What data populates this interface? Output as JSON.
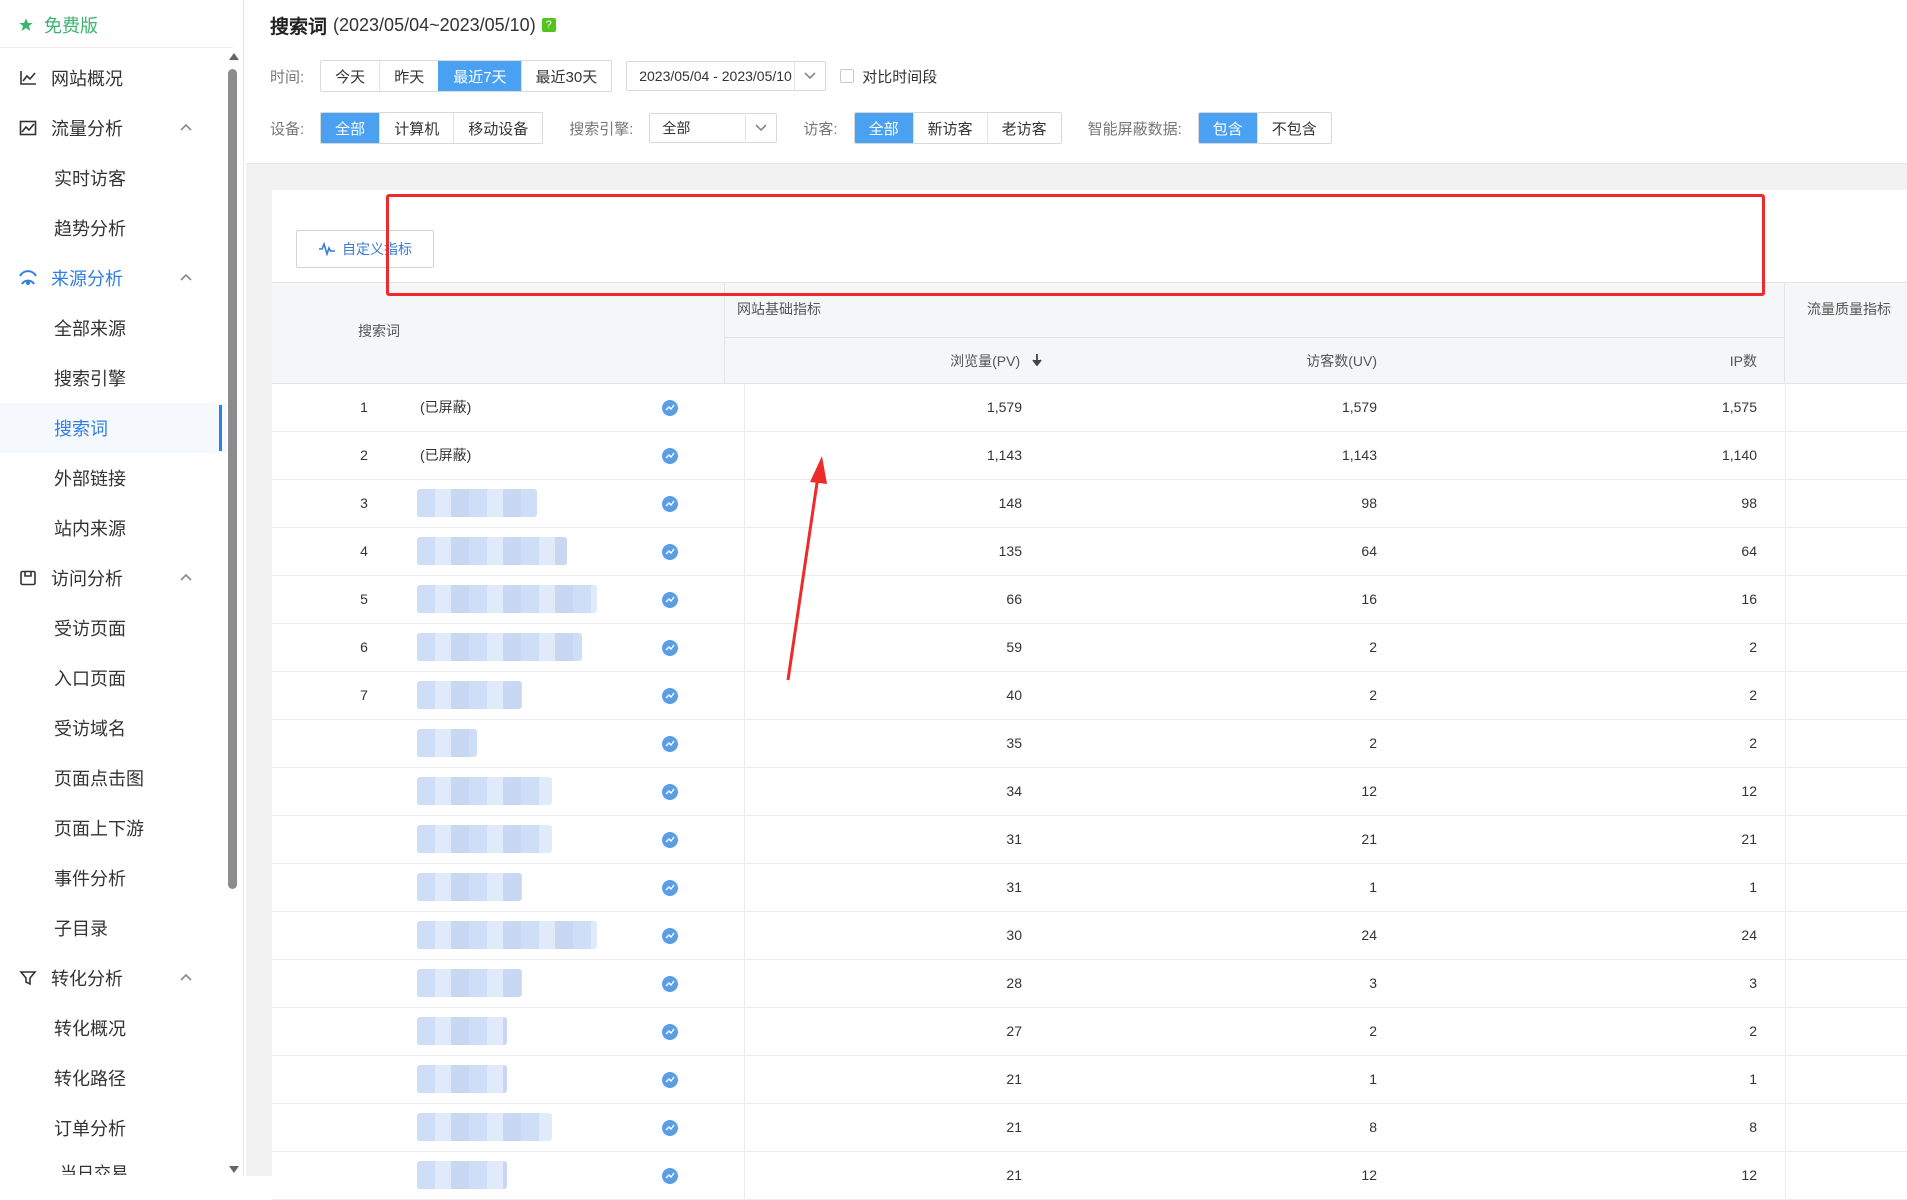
{
  "sidebar": {
    "brand": "免费版",
    "groups": [
      {
        "label": "网站概况",
        "icon": "line-chart-icon",
        "items": []
      },
      {
        "label": "流量分析",
        "icon": "area-chart-icon",
        "items": [
          "实时访客",
          "趋势分析"
        ]
      },
      {
        "label": "来源分析",
        "icon": "signal-icon",
        "items": [
          "全部来源",
          "搜索引擎",
          "搜索词",
          "外部链接",
          "站内来源"
        ]
      },
      {
        "label": "访问分析",
        "icon": "save-icon",
        "items": [
          "受访页面",
          "入口页面",
          "受访域名",
          "页面点击图",
          "页面上下游",
          "事件分析",
          "子目录"
        ]
      },
      {
        "label": "转化分析",
        "icon": "funnel-icon",
        "items": [
          "转化概况",
          "转化路径",
          "订单分析"
        ]
      }
    ],
    "active_item": "搜索词",
    "partial_item": "当日交易"
  },
  "header": {
    "title": "搜索词",
    "date_range": "(2023/05/04~2023/05/10)",
    "help": "?",
    "time_label": "时间:",
    "time_options": [
      "今天",
      "昨天",
      "最近7天",
      "最近30天"
    ],
    "time_selected": "最近7天",
    "date_picker_value": "2023/05/04 - 2023/05/10",
    "compare_label": "对比时间段",
    "device_label": "设备:",
    "device_options": [
      "全部",
      "计算机",
      "移动设备"
    ],
    "device_selected": "全部",
    "engine_label": "搜索引擎:",
    "engine_value": "全部",
    "visitor_label": "访客:",
    "visitor_options": [
      "全部",
      "新访客",
      "老访客"
    ],
    "visitor_selected": "全部",
    "mask_label": "智能屏蔽数据:",
    "mask_options": [
      "包含",
      "不包含"
    ],
    "mask_selected": "包含"
  },
  "toolbar": {
    "custom_metrics_label": "自定义指标"
  },
  "table": {
    "col_keyword": "搜索词",
    "group_basic": "网站基础指标",
    "group_quality": "流量质量指标",
    "col_pv": "浏览量(PV)",
    "col_uv": "访客数(UV)",
    "col_ip": "IP数",
    "rows": [
      {
        "idx": "1",
        "keyword": "(已屏蔽)",
        "pv": "1,579",
        "uv": "1,579",
        "ip": "1,575"
      },
      {
        "idx": "2",
        "keyword": "(已屏蔽)",
        "pv": "1,143",
        "uv": "1,143",
        "ip": "1,140"
      },
      {
        "idx": "3",
        "keyword": "",
        "pv": "148",
        "uv": "98",
        "ip": "98"
      },
      {
        "idx": "4",
        "keyword": "",
        "pv": "135",
        "uv": "64",
        "ip": "64"
      },
      {
        "idx": "5",
        "keyword": "",
        "pv": "66",
        "uv": "16",
        "ip": "16"
      },
      {
        "idx": "6",
        "keyword": "",
        "pv": "59",
        "uv": "2",
        "ip": "2"
      },
      {
        "idx": "7",
        "keyword": "",
        "pv": "40",
        "uv": "2",
        "ip": "2"
      },
      {
        "idx": "",
        "keyword": "",
        "pv": "35",
        "uv": "2",
        "ip": "2"
      },
      {
        "idx": "",
        "keyword": "",
        "pv": "34",
        "uv": "12",
        "ip": "12"
      },
      {
        "idx": "",
        "keyword": "",
        "pv": "31",
        "uv": "21",
        "ip": "21"
      },
      {
        "idx": "",
        "keyword": "",
        "pv": "31",
        "uv": "1",
        "ip": "1"
      },
      {
        "idx": "",
        "keyword": "",
        "pv": "30",
        "uv": "24",
        "ip": "24"
      },
      {
        "idx": "",
        "keyword": "",
        "pv": "28",
        "uv": "3",
        "ip": "3"
      },
      {
        "idx": "",
        "keyword": "",
        "pv": "27",
        "uv": "2",
        "ip": "2"
      },
      {
        "idx": "",
        "keyword": "",
        "pv": "21",
        "uv": "1",
        "ip": "1"
      },
      {
        "idx": "",
        "keyword": "",
        "pv": "21",
        "uv": "8",
        "ip": "8"
      },
      {
        "idx": "",
        "keyword": "",
        "pv": "21",
        "uv": "12",
        "ip": "12"
      }
    ]
  },
  "colors": {
    "accent": "#4aa1f2",
    "active": "#2f7ee5",
    "brand": "#3cb371",
    "annotation": "#ee2b2b"
  }
}
